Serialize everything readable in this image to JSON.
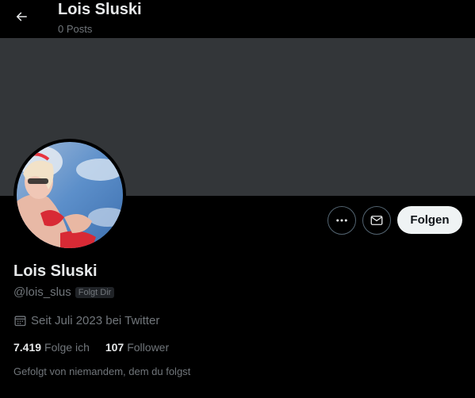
{
  "header": {
    "back_icon": "arrow-left-icon",
    "name": "Lois Sluski",
    "posts": "0 Posts"
  },
  "colors": {
    "background": "#000000",
    "banner": "#333639",
    "text_primary": "#e7e9ea",
    "text_secondary": "#71767b",
    "follow_button_bg": "#eff3f4"
  },
  "actions": {
    "more_icon": "more-horizontal-icon",
    "message_icon": "envelope-icon",
    "follow_label": "Folgen"
  },
  "profile": {
    "display_name": "Lois Sluski",
    "handle": "@lois_slus",
    "follows_you_badge": "Folgt Dir",
    "joined_icon": "calendar-icon",
    "joined": "Seit Juli 2023 bei Twitter",
    "following_count": "7.419",
    "following_label": "Folge ich",
    "followers_count": "107",
    "followers_label": "Follower",
    "followed_by": "Gefolgt von niemandem, dem du folgst"
  }
}
